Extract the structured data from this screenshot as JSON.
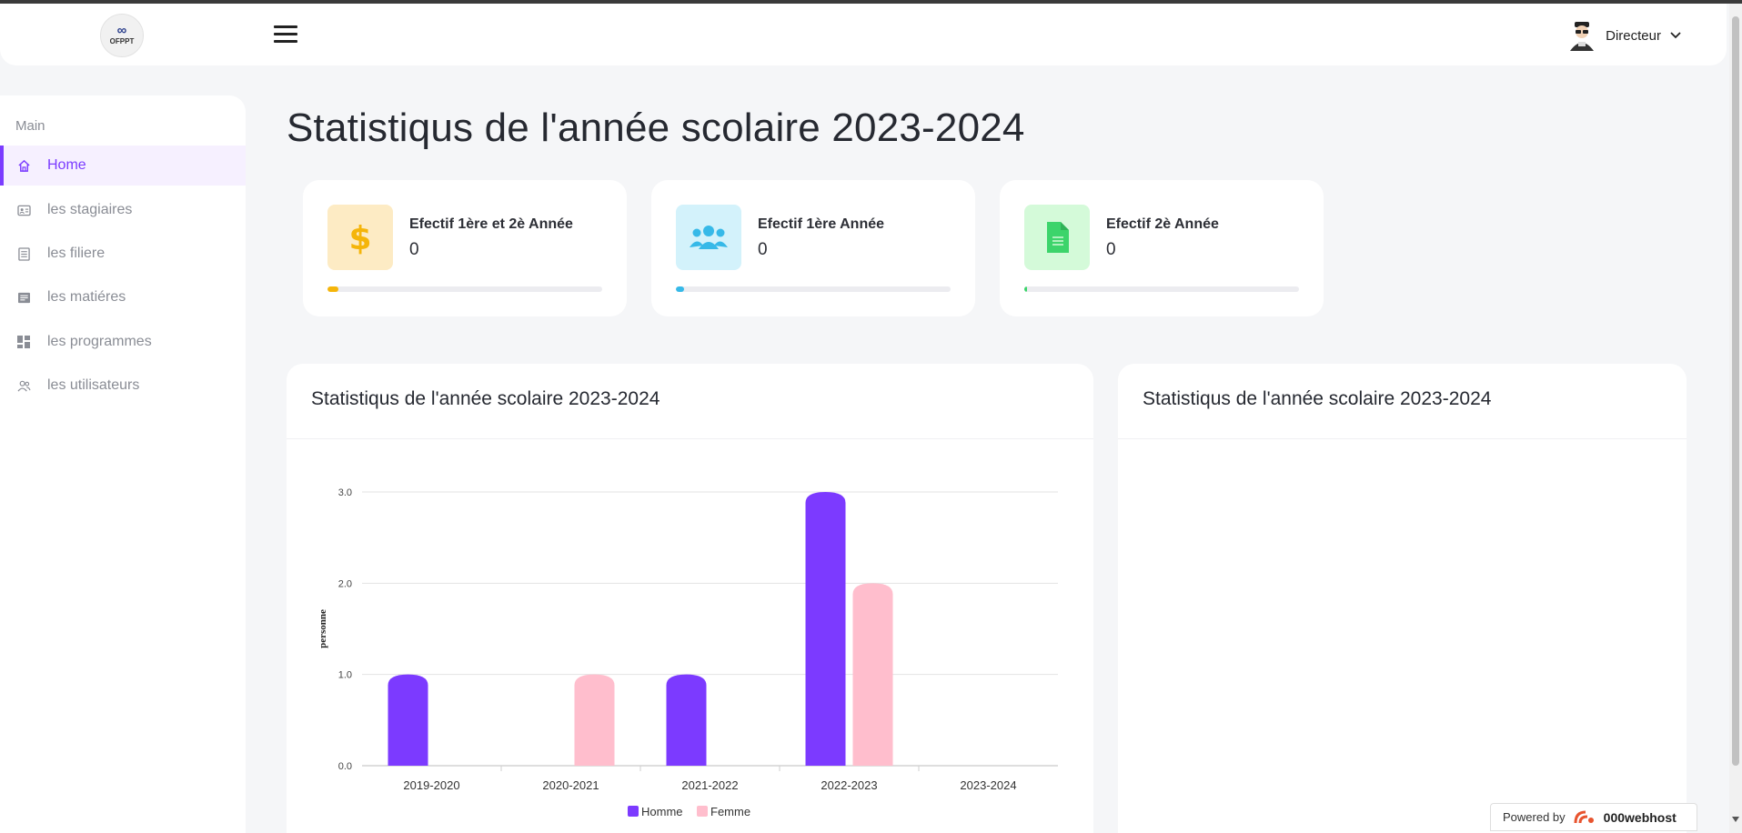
{
  "header": {
    "logo_text": "OFPPT",
    "user_name": "Directeur",
    "chevron": "⌄"
  },
  "sidebar": {
    "section": "Main",
    "items": [
      {
        "label": "Home",
        "icon": "home-icon",
        "active": true
      },
      {
        "label": "les stagiaires",
        "icon": "id-card-icon",
        "active": false
      },
      {
        "label": "les filiere",
        "icon": "list-icon",
        "active": false
      },
      {
        "label": "les matiéres",
        "icon": "document-icon",
        "active": false
      },
      {
        "label": "les programmes",
        "icon": "dashboard-icon",
        "active": false
      },
      {
        "label": "les utilisateurs",
        "icon": "users-icon",
        "active": false
      }
    ]
  },
  "main": {
    "title": "Statistiqus de l'année scolaire 2023-2024",
    "cards": [
      {
        "title": "Efectif 1ère et 2è Année",
        "value": "0",
        "icon": "dollar-icon",
        "color": "#f5b50a",
        "badge_bg": "#fdebc4",
        "progress": 0.04
      },
      {
        "title": "Efectif 1ère Année",
        "value": "0",
        "icon": "users-icon",
        "color": "#36b9e8",
        "badge_bg": "#d3f2fb",
        "progress": 0.03
      },
      {
        "title": "Efectif 2è Année",
        "value": "0",
        "icon": "file-icon",
        "color": "#3cd46b",
        "badge_bg": "#d4fad9",
        "progress": 0.01
      }
    ],
    "panel_left_title": "Statistiqus de l'année scolaire 2023-2024",
    "panel_right_title": "Statistiqus de l'année scolaire 2023-2024"
  },
  "chart_data": {
    "type": "bar",
    "categories": [
      "2019-2020",
      "2020-2021",
      "2021-2022",
      "2022-2023",
      "2023-2024"
    ],
    "series": [
      {
        "name": "Homme",
        "color": "#7c3aff",
        "values": [
          1,
          0,
          1,
          3,
          0
        ]
      },
      {
        "name": "Femme",
        "color": "#ffbecd",
        "values": [
          0,
          1,
          0,
          2,
          0
        ]
      }
    ],
    "ylabel": "personne",
    "yticks": [
      "0.0",
      "1.0",
      "2.0",
      "3.0"
    ],
    "ylim": [
      0,
      3
    ],
    "grid": true,
    "legend_position": "bottom"
  },
  "footer": {
    "powered_by": "Powered by",
    "brand": "000webhost"
  }
}
